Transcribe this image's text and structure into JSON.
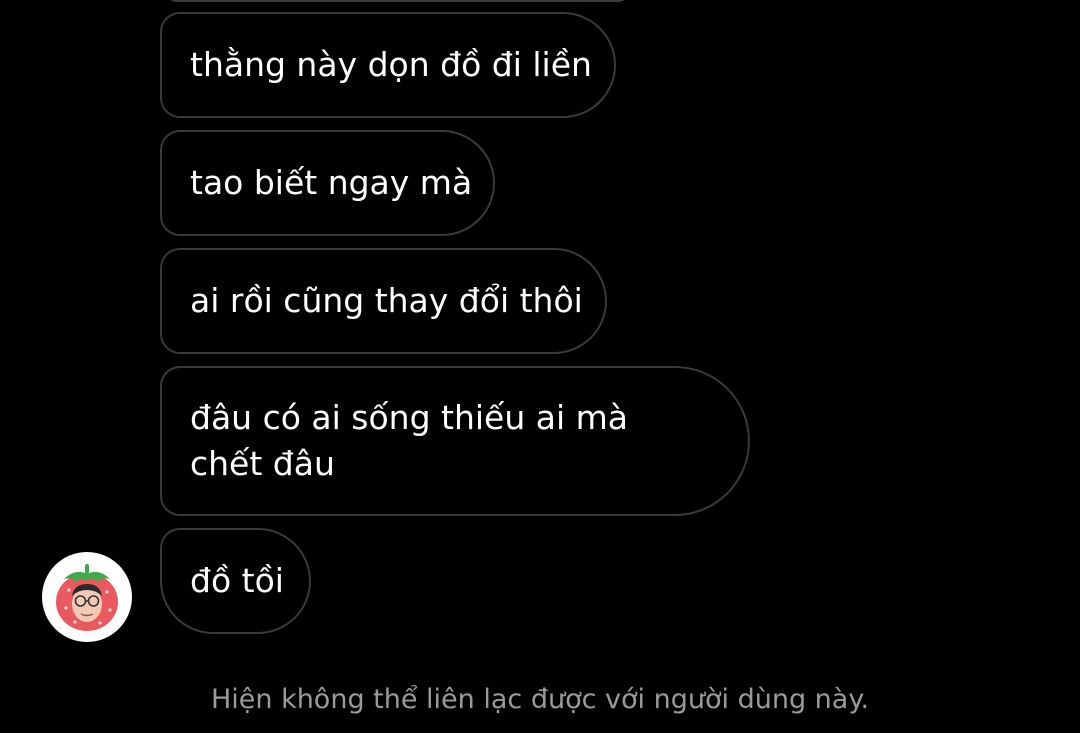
{
  "conversation": {
    "messages": [
      {
        "text": "thằng này dọn đồ đi liền"
      },
      {
        "text": "tao biết ngay mà"
      },
      {
        "text": "ai rồi cũng thay đổi thôi"
      },
      {
        "text": "đâu có ai sống thiếu ai mà chết đâu"
      },
      {
        "text": "đồ tồi"
      }
    ],
    "sender_avatar_icon": "strawberry-avatar-icon",
    "status_text": "Hiện không thể liên lạc được với người dùng này."
  },
  "colors": {
    "background": "#000000",
    "bubble_border": "#3a3a3a",
    "message_text": "#ffffff",
    "status_text": "#9a9a9a",
    "avatar_red": "#e85a5f",
    "avatar_green": "#3faa4a"
  }
}
